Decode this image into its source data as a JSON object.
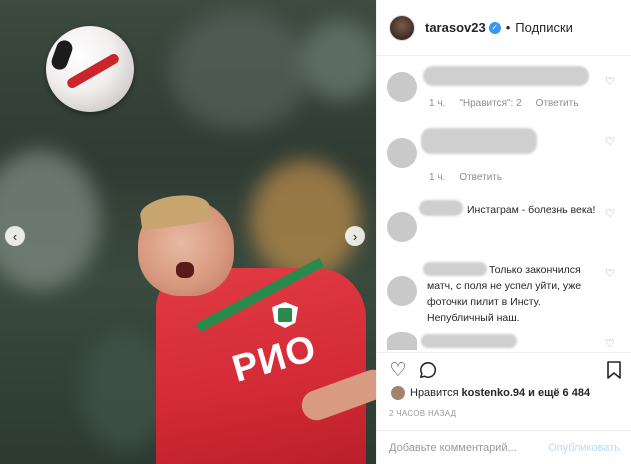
{
  "post": {
    "username": "tarasov23",
    "follow_label": "Подписки",
    "verified_icon": "verified-check-icon",
    "shirt_text": "PИO"
  },
  "comments": [
    {
      "time": "1 ч.",
      "likes": "\"Нравится\": 2",
      "reply": "Ответить",
      "text": ""
    },
    {
      "time": "1 ч.",
      "likes": "",
      "reply": "Ответить",
      "text": ""
    },
    {
      "time": "",
      "likes": "",
      "reply": "",
      "text": "Инстаграм - болезнь века!"
    },
    {
      "time": "",
      "likes": "",
      "reply": "",
      "text": "Только закончился матч, с поля не успел уйти, уже фоточки пилит в Инсту. Непубличный наш."
    }
  ],
  "actions": {
    "like_icon": "heart-icon",
    "comment_icon": "comment-icon",
    "save_icon": "bookmark-icon"
  },
  "likes_summary": {
    "prefix": "Нравится",
    "user": "kostenko.94",
    "suffix": "и ещё 6 484"
  },
  "timestamp": "2 ЧАСОВ НАЗАД",
  "comment_box": {
    "placeholder": "Добавьте комментарий...",
    "publish_label": "Опубликовать"
  },
  "nav": {
    "prev_icon": "chevron-left-icon",
    "next_icon": "chevron-right-icon"
  },
  "colors": {
    "accent_blue": "#3897f0",
    "publish_disabled": "#b2dffc",
    "jersey_red": "#d32a36",
    "jersey_green": "#2a8a4b"
  }
}
